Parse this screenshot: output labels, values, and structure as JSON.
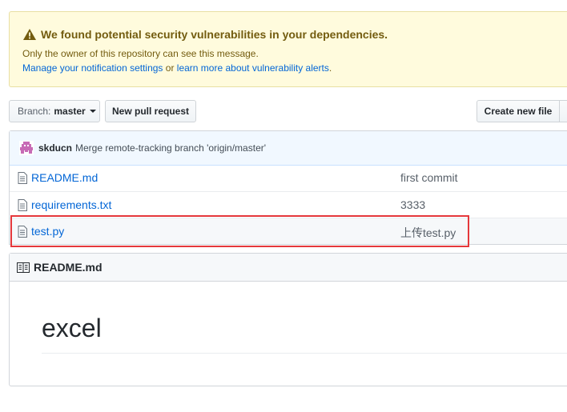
{
  "alert": {
    "title": "We found potential security vulnerabilities in your dependencies.",
    "line1": "Only the owner of this repository can see this message.",
    "link1": "Manage your notification settings",
    "or_text": " or ",
    "link2": "learn more about vulnerability alerts",
    "period": "."
  },
  "toolbar": {
    "branch_prefix": "Branch:",
    "branch_name": "master",
    "new_pr_label": "New pull request",
    "create_file_label": "Create new file"
  },
  "commit": {
    "author": "skducn",
    "message": "Merge remote-tracking branch 'origin/master'"
  },
  "files": [
    {
      "name": "README.md",
      "message": "first commit"
    },
    {
      "name": "requirements.txt",
      "message": "3333"
    },
    {
      "name": "test.py",
      "message": "上传test.py"
    }
  ],
  "readme": {
    "header": "README.md",
    "heading": "excel"
  },
  "colors": {
    "link": "#0366d6",
    "alert_bg": "#fffbdd",
    "alert_text": "#735c0f",
    "highlight": "#e5383b"
  },
  "icons": [
    "alert-icon",
    "caret-down-icon",
    "avatar",
    "file-icon",
    "book-icon"
  ]
}
